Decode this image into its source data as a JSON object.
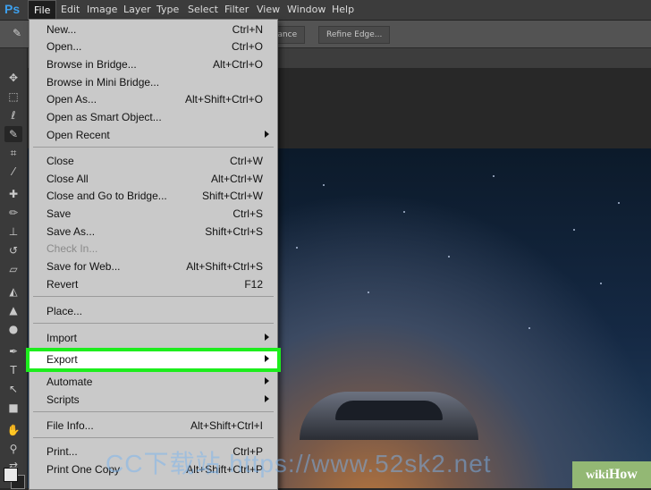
{
  "app": {
    "logo": "Ps"
  },
  "menubar": {
    "items": [
      "File",
      "Edit",
      "Image",
      "Layer",
      "Type",
      "Select",
      "Filter",
      "View",
      "Window",
      "Help"
    ]
  },
  "options_bar": {
    "enhance_label": "nhance",
    "refine_edge_label": "Refine Edge..."
  },
  "file_menu": {
    "items": [
      {
        "label": "New...",
        "shortcut": "Ctrl+N"
      },
      {
        "label": "Open...",
        "shortcut": "Ctrl+O"
      },
      {
        "label": "Browse in Bridge...",
        "shortcut": "Alt+Ctrl+O"
      },
      {
        "label": "Browse in Mini Bridge...",
        "shortcut": ""
      },
      {
        "label": "Open As...",
        "shortcut": "Alt+Shift+Ctrl+O"
      },
      {
        "label": "Open as Smart Object...",
        "shortcut": ""
      },
      {
        "label": "Open Recent",
        "shortcut": ""
      },
      {
        "label": "Close",
        "shortcut": "Ctrl+W"
      },
      {
        "label": "Close All",
        "shortcut": "Alt+Ctrl+W"
      },
      {
        "label": "Close and Go to Bridge...",
        "shortcut": "Shift+Ctrl+W"
      },
      {
        "label": "Save",
        "shortcut": "Ctrl+S"
      },
      {
        "label": "Save As...",
        "shortcut": "Shift+Ctrl+S"
      },
      {
        "label": "Check In...",
        "shortcut": ""
      },
      {
        "label": "Save for Web...",
        "shortcut": "Alt+Shift+Ctrl+S"
      },
      {
        "label": "Revert",
        "shortcut": "F12"
      },
      {
        "label": "Place...",
        "shortcut": ""
      },
      {
        "label": "Import",
        "shortcut": ""
      },
      {
        "label": "Export",
        "shortcut": ""
      },
      {
        "label": "Automate",
        "shortcut": ""
      },
      {
        "label": "Scripts",
        "shortcut": ""
      },
      {
        "label": "File Info...",
        "shortcut": "Alt+Shift+Ctrl+I"
      },
      {
        "label": "Print...",
        "shortcut": "Ctrl+P"
      },
      {
        "label": "Print One Copy",
        "shortcut": "Alt+Shift+Ctrl+P"
      }
    ]
  },
  "watermark": "CC下载站 https://www.52sk2.net",
  "wikihow": {
    "wiki": "wiki",
    "how": "How"
  },
  "colors": {
    "highlight_outline": "#1ded1d",
    "menu_bg": "#c9c9c9",
    "logo": "#3da0ee"
  }
}
